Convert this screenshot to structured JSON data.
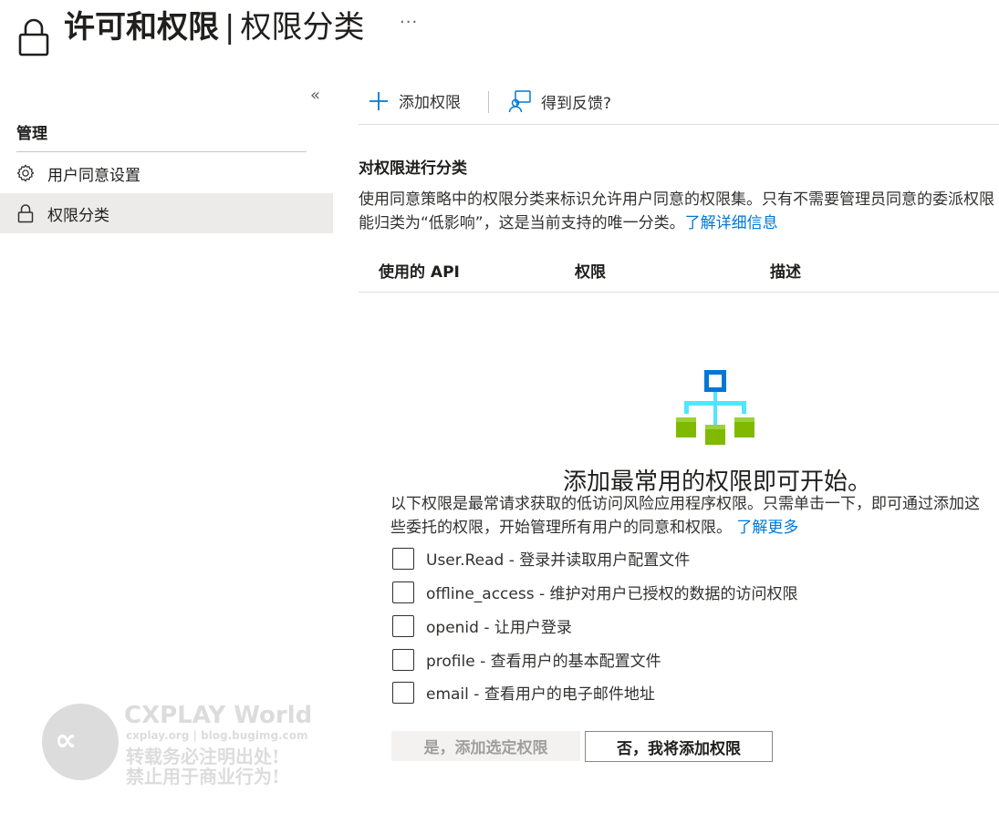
{
  "header": {
    "icon": "lock-icon",
    "title": "许可和权限",
    "separator": "|",
    "subtitle": "权限分类",
    "more_label": "···"
  },
  "sidebar": {
    "collapse_label": "«",
    "section_heading": "管理",
    "items": [
      {
        "label": "用户同意设置",
        "icon": "gear-icon",
        "selected": false
      },
      {
        "label": "权限分类",
        "icon": "lock-icon",
        "selected": true
      }
    ]
  },
  "toolbar": {
    "add_label": "添加权限",
    "add_icon": "plus-icon",
    "feedback_label": "得到反馈?",
    "feedback_icon": "feedback-icon"
  },
  "section": {
    "title": "对权限进行分类",
    "desc_line1": "使用同意策略中的权限分类来标识允许用户同意的权限集。只有不需要管理员同意的委派权限",
    "desc_line2": "能归类为“低影响”，这是当前支持的唯一分类。",
    "learn_more": "了解详细信息"
  },
  "table": {
    "columns": [
      "使用的 API",
      "权限",
      "描述"
    ]
  },
  "empty_state": {
    "icon": "hierarchy-icon",
    "title": "添加最常用的权限即可开始。",
    "desc_line1": "以下权限是最常请求获取的低访问风险应用程序权限。只需单击一下，即可通过添加这",
    "desc_line2": "些委托的权限，开始管理所有用户的同意和权限。",
    "learn_more": "了解更多"
  },
  "permissions": [
    {
      "label": "User.Read - 登录并读取用户配置文件",
      "checked": false
    },
    {
      "label": "offline_access - 维护对用户已授权的数据的访问权限",
      "checked": false
    },
    {
      "label": "openid - 让用户登录",
      "checked": false
    },
    {
      "label": "profile - 查看用户的基本配置文件",
      "checked": false
    },
    {
      "label": "email - 查看用户的电子邮件地址",
      "checked": false
    }
  ],
  "actions": {
    "yes_label": "是，添加选定权限",
    "no_label": "否，我将添加权限"
  },
  "watermark": {
    "brand": "CXPLAY World",
    "site": "cxplay.org | blog.bugimg.com",
    "line1": "转载务必注明出处!",
    "line2": "禁止用于商业行为!"
  },
  "colors": {
    "accent": "#0078d4",
    "selected_bg": "#edebe9",
    "disabled_bg": "#f3f2f1"
  }
}
